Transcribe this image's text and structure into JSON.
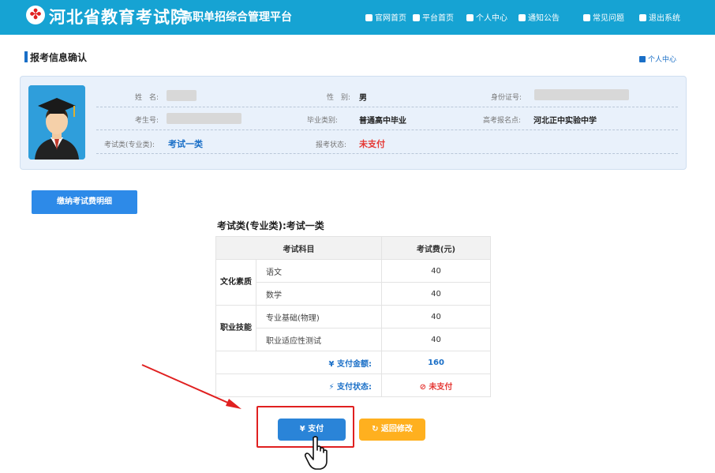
{
  "header": {
    "logo_glyph": "✤",
    "site_title": "河北省教育考试院",
    "site_subtitle": "高职单招综合管理平台",
    "nav": [
      {
        "label": "官网首页",
        "icon": "home-icon"
      },
      {
        "label": "平台首页",
        "icon": "platform-home-icon"
      },
      {
        "label": "个人中心",
        "icon": "user-icon"
      },
      {
        "label": "通知公告",
        "icon": "notice-icon"
      },
      {
        "label": "常见问题",
        "icon": "faq-icon"
      },
      {
        "label": "退出系统",
        "icon": "logout-icon"
      }
    ]
  },
  "section": {
    "title": "报考信息确认",
    "personal_center_link": "个人中心"
  },
  "profile": {
    "name_label": "姓　名:",
    "name_value": "",
    "gender_label": "性　别:",
    "gender_value": "男",
    "id_label": "身份证号:",
    "id_value": "",
    "candidate_no_label": "考生号:",
    "candidate_no_value": "",
    "grad_type_label": "毕业类别:",
    "grad_type_value": "普通高中毕业",
    "gaokao_site_label": "高考报名点:",
    "gaokao_site_value": "河北正中实验中学",
    "exam_category_label": "考试类(专业类):",
    "exam_category_value": "考试一类",
    "status_label": "报考状态:",
    "status_value": "未支付"
  },
  "fee_detail_button": "缴纳考试费明细",
  "exam_category_heading": "考试类(专业类):考试一类",
  "fee_table": {
    "headers": [
      "考试科目",
      "考试费(元)"
    ],
    "groups": [
      {
        "name": "文化素质",
        "rows": [
          {
            "subject": "语文",
            "fee": "40"
          },
          {
            "subject": "数学",
            "fee": "40"
          }
        ]
      },
      {
        "name": "职业技能",
        "rows": [
          {
            "subject": "专业基础(物理)",
            "fee": "40"
          },
          {
            "subject": "职业适应性测试",
            "fee": "40"
          }
        ]
      }
    ],
    "total_label": "¥ 支付金额:",
    "total_value": "160",
    "pay_status_label": "⚡ 支付状态:",
    "pay_status_value": "⊘ 未支付"
  },
  "actions": {
    "pay_button": "¥ 支付",
    "back_button": "↻ 返回修改"
  },
  "colors": {
    "header_bg": "#16a3d3",
    "primary_blue": "#2a84d8",
    "warning_red": "#e53935",
    "back_orange": "#ffb01f"
  }
}
